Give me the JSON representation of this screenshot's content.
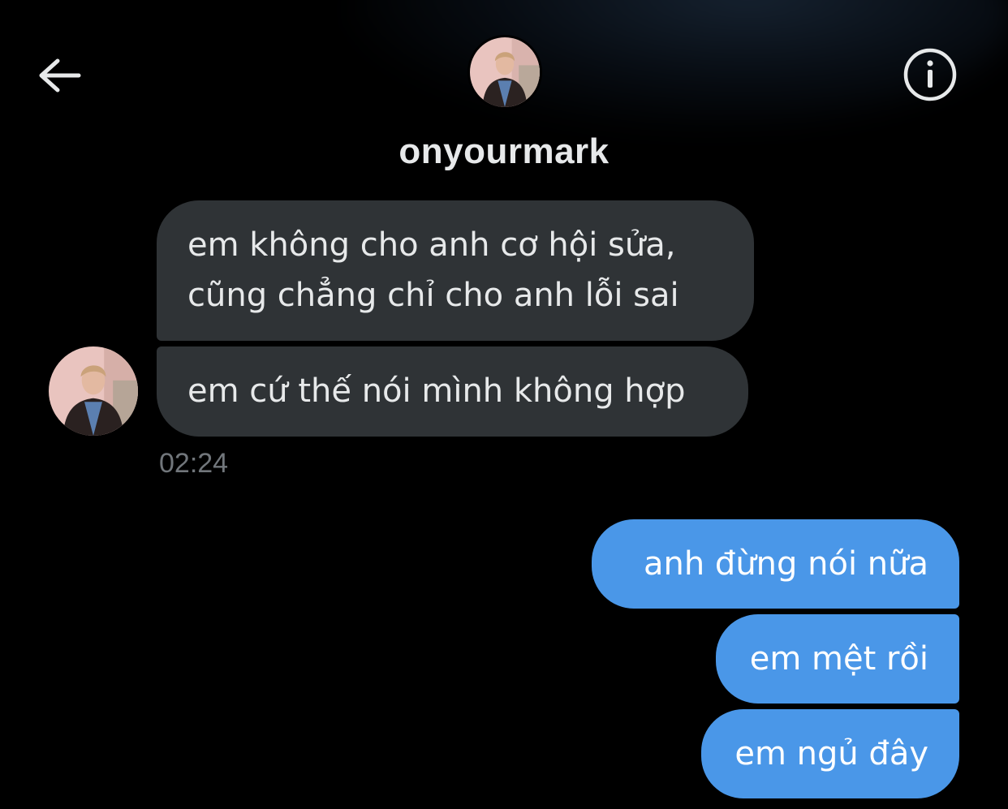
{
  "header": {
    "contact_name": "onyourmark",
    "back_icon": "arrow-left-icon",
    "info_icon": "info-icon"
  },
  "conversation": {
    "incoming": [
      {
        "lines": [
          "em không cho anh cơ hội sửa,",
          "cũng chẳng chỉ cho anh lỗi sai"
        ]
      },
      {
        "lines": [
          "em cứ thế nói mình không hợp"
        ]
      }
    ],
    "incoming_timestamp": "02:24",
    "outgoing": [
      {
        "text": "anh đừng nói nữa"
      },
      {
        "text": "em mệt rồi"
      },
      {
        "text": "em ngủ đây"
      }
    ]
  },
  "colors": {
    "background": "#000000",
    "incoming_bubble": "#2f3336",
    "outgoing_bubble": "#4a97e8",
    "timestamp": "#71767b"
  }
}
